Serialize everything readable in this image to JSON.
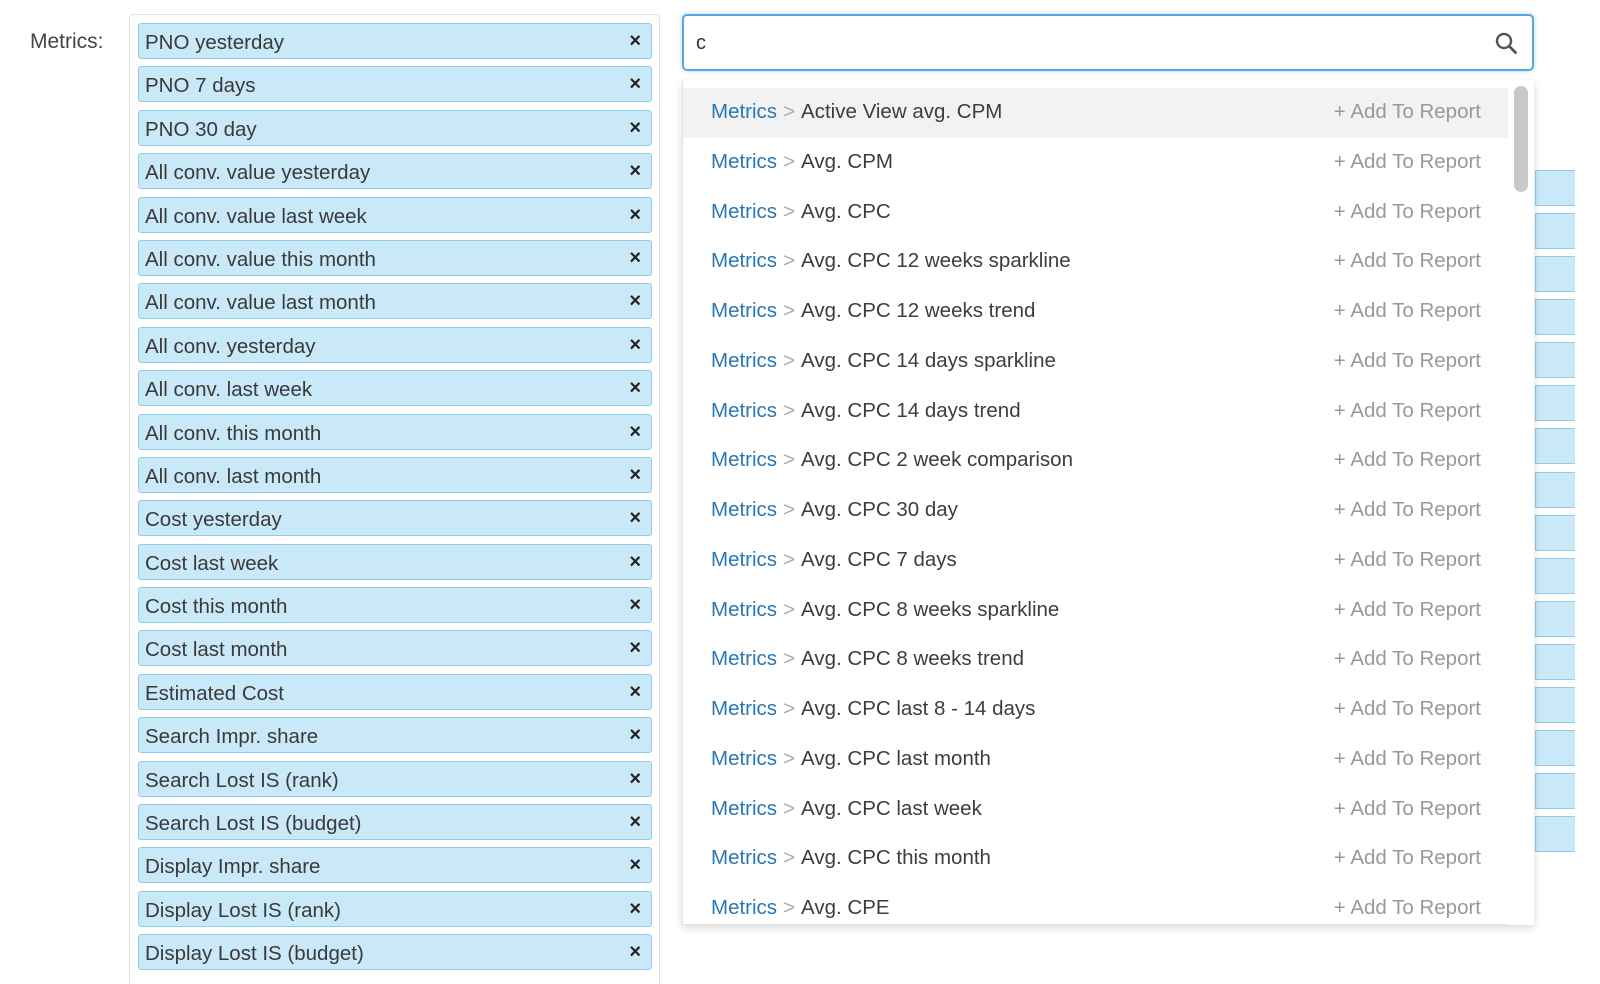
{
  "metrics_label": "Metrics:",
  "selected_metrics": [
    "PNO yesterday",
    "PNO 7 days",
    "PNO 30 day",
    "All conv. value yesterday",
    "All conv. value last week",
    "All conv. value this month",
    "All conv. value last month",
    "All conv. yesterday",
    "All conv. last week",
    "All conv. this month",
    "All conv. last month",
    "Cost yesterday",
    "Cost last week",
    "Cost this month",
    "Cost last month",
    "Estimated Cost",
    "Search Impr. share",
    "Search Lost IS (rank)",
    "Search Lost IS (budget)",
    "Display Impr. share",
    "Display Lost IS (rank)",
    "Display Lost IS (budget)"
  ],
  "remove_symbol": "×",
  "search": {
    "value": "c",
    "icon": "search-icon"
  },
  "results": [
    {
      "category": "Metrics",
      "name": "Active View avg. CPM",
      "action": "+ Add To Report"
    },
    {
      "category": "Metrics",
      "name": "Avg. CPM",
      "action": "+ Add To Report"
    },
    {
      "category": "Metrics",
      "name": "Avg. CPC",
      "action": "+ Add To Report"
    },
    {
      "category": "Metrics",
      "name": "Avg. CPC 12 weeks sparkline",
      "action": "+ Add To Report"
    },
    {
      "category": "Metrics",
      "name": "Avg. CPC 12 weeks trend",
      "action": "+ Add To Report"
    },
    {
      "category": "Metrics",
      "name": "Avg. CPC 14 days sparkline",
      "action": "+ Add To Report"
    },
    {
      "category": "Metrics",
      "name": "Avg. CPC 14 days trend",
      "action": "+ Add To Report"
    },
    {
      "category": "Metrics",
      "name": "Avg. CPC 2 week comparison",
      "action": "+ Add To Report"
    },
    {
      "category": "Metrics",
      "name": "Avg. CPC 30 day",
      "action": "+ Add To Report"
    },
    {
      "category": "Metrics",
      "name": "Avg. CPC 7 days",
      "action": "+ Add To Report"
    },
    {
      "category": "Metrics",
      "name": "Avg. CPC 8 weeks sparkline",
      "action": "+ Add To Report"
    },
    {
      "category": "Metrics",
      "name": "Avg. CPC 8 weeks trend",
      "action": "+ Add To Report"
    },
    {
      "category": "Metrics",
      "name": "Avg. CPC last 8 - 14 days",
      "action": "+ Add To Report"
    },
    {
      "category": "Metrics",
      "name": "Avg. CPC last month",
      "action": "+ Add To Report"
    },
    {
      "category": "Metrics",
      "name": "Avg. CPC last week",
      "action": "+ Add To Report"
    },
    {
      "category": "Metrics",
      "name": "Avg. CPC this month",
      "action": "+ Add To Report"
    },
    {
      "category": "Metrics",
      "name": "Avg. CPE",
      "action": "+ Add To Report"
    }
  ],
  "breadcrumb_separator": ">",
  "colors": {
    "tag_bg": "#c9e8f8",
    "tag_border": "#93cbe8",
    "link": "#2a77b5",
    "focus_border": "#5aa6dc",
    "highlight_row": "#f2f2f2"
  }
}
